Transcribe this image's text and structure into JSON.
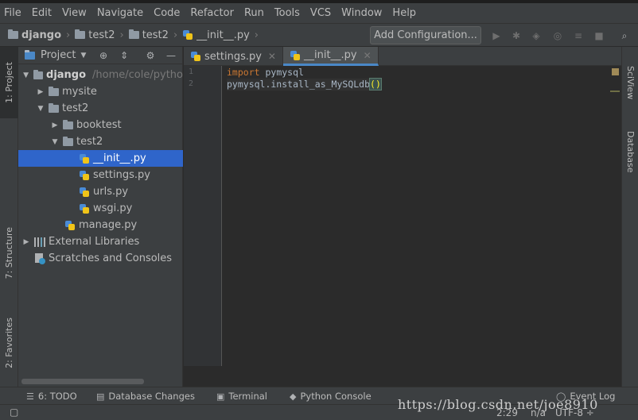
{
  "menu": [
    "File",
    "Edit",
    "View",
    "Navigate",
    "Code",
    "Refactor",
    "Run",
    "Tools",
    "VCS",
    "Window",
    "Help"
  ],
  "breadcrumb": [
    {
      "label": "django",
      "bold": true
    },
    {
      "label": "test2"
    },
    {
      "label": "test2"
    },
    {
      "label": "__init__.py"
    }
  ],
  "toolbar": {
    "add_configuration": "Add Configuration..."
  },
  "left_tabs": {
    "project": "1: Project",
    "structure": "7: Structure",
    "favorites": "2: Favorites"
  },
  "right_tabs": {
    "sciview": "SciView",
    "database": "Database"
  },
  "project_panel": {
    "title": "Project"
  },
  "tree": [
    {
      "label": "django",
      "path": "/home/cole/pytho",
      "depth": 0,
      "type": "folder",
      "expanded": true,
      "bold": true
    },
    {
      "label": "mysite",
      "depth": 1,
      "type": "folder",
      "expanded": false
    },
    {
      "label": "test2",
      "depth": 1,
      "type": "folder",
      "expanded": true
    },
    {
      "label": "booktest",
      "depth": 2,
      "type": "folder",
      "expanded": false
    },
    {
      "label": "test2",
      "depth": 2,
      "type": "folder",
      "expanded": true
    },
    {
      "label": "__init__.py",
      "depth": 3,
      "type": "py",
      "selected": true
    },
    {
      "label": "settings.py",
      "depth": 3,
      "type": "py"
    },
    {
      "label": "urls.py",
      "depth": 3,
      "type": "py"
    },
    {
      "label": "wsgi.py",
      "depth": 3,
      "type": "py"
    },
    {
      "label": "manage.py",
      "depth": 2,
      "type": "py"
    },
    {
      "label": "External Libraries",
      "depth": 0,
      "type": "lib",
      "expanded": false
    },
    {
      "label": "Scratches and Consoles",
      "depth": 0,
      "type": "scratch"
    }
  ],
  "editor_tabs": [
    {
      "label": "settings.py",
      "active": false
    },
    {
      "label": "__init__.py",
      "active": true
    }
  ],
  "code": {
    "line_numbers": [
      "1",
      "2"
    ],
    "line1_keyword": "import",
    "line1_rest": " pymysql",
    "line2_text": "pymysql.install_as_MySQLdb",
    "line2_parens": "()"
  },
  "bottom_tools": {
    "todo": "6: TODO",
    "db_changes": "Database Changes",
    "terminal": "Terminal",
    "python_console": "Python Console",
    "event_log": "Event Log"
  },
  "status": {
    "position": "2:29",
    "na": "n/a",
    "encoding": "UTF-8 ÷"
  },
  "watermark": "https://blog.csdn.net/joe8910"
}
